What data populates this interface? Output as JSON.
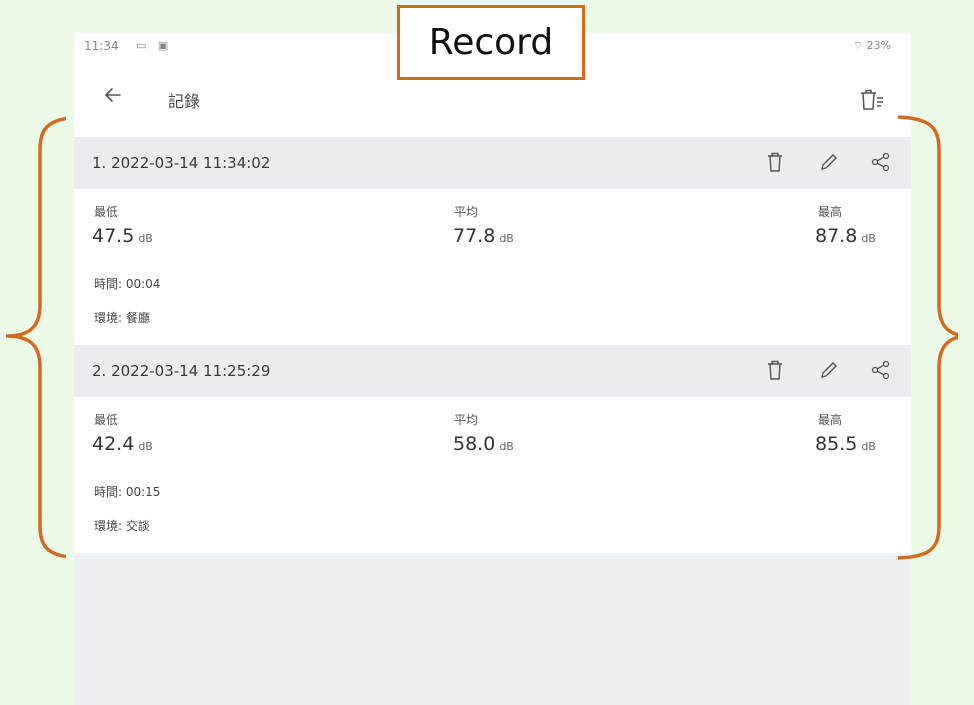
{
  "badge": {
    "label": "Record"
  },
  "status_bar": {
    "time": "11:34",
    "icons": "▭ ▣",
    "right": "⌔ 23%"
  },
  "app_bar": {
    "title": "記錄",
    "back_icon": "arrow-left-icon",
    "clear_icon": "trash-list-icon"
  },
  "records": [
    {
      "title": "1. 2022-03-14 11:34:02",
      "min_label": "最低",
      "min_value": "47.5",
      "min_unit": "dB",
      "avg_label": "平均",
      "avg_value": "77.8",
      "avg_unit": "dB",
      "max_label": "最高",
      "max_value": "87.8",
      "max_unit": "dB",
      "duration": "時間: 00:04",
      "environment": "環境: 餐廳"
    },
    {
      "title": "2. 2022-03-14 11:25:29",
      "min_label": "最低",
      "min_value": "42.4",
      "min_unit": "dB",
      "avg_label": "平均",
      "avg_value": "58.0",
      "avg_unit": "dB",
      "max_label": "最高",
      "max_value": "85.5",
      "max_unit": "dB",
      "duration": "時間: 00:15",
      "environment": "環境: 交談"
    }
  ],
  "colors": {
    "annotation": "#d7691f",
    "outer_bg": "#ebfbe8",
    "card_header": "#ececf0"
  }
}
